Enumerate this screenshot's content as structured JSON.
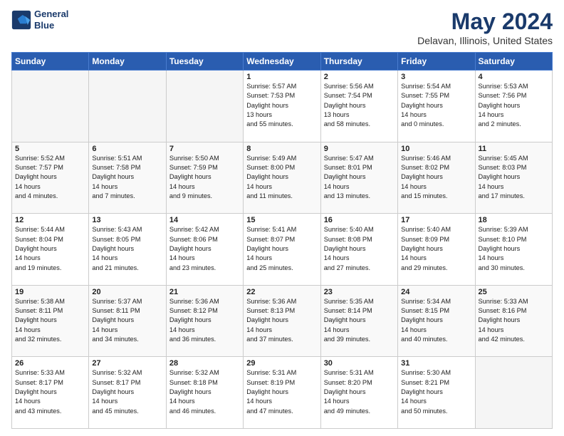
{
  "header": {
    "logo_line1": "General",
    "logo_line2": "Blue",
    "title": "May 2024",
    "subtitle": "Delavan, Illinois, United States"
  },
  "days_of_week": [
    "Sunday",
    "Monday",
    "Tuesday",
    "Wednesday",
    "Thursday",
    "Friday",
    "Saturday"
  ],
  "weeks": [
    [
      {
        "day": "",
        "sunrise": "",
        "sunset": "",
        "daylight": "",
        "empty": true
      },
      {
        "day": "",
        "sunrise": "",
        "sunset": "",
        "daylight": "",
        "empty": true
      },
      {
        "day": "",
        "sunrise": "",
        "sunset": "",
        "daylight": "",
        "empty": true
      },
      {
        "day": "1",
        "sunrise": "5:57 AM",
        "sunset": "7:53 PM",
        "daylight1": "13 hours",
        "daylight2": "and 55 minutes.",
        "empty": false
      },
      {
        "day": "2",
        "sunrise": "5:56 AM",
        "sunset": "7:54 PM",
        "daylight1": "13 hours",
        "daylight2": "and 58 minutes.",
        "empty": false
      },
      {
        "day": "3",
        "sunrise": "5:54 AM",
        "sunset": "7:55 PM",
        "daylight1": "14 hours",
        "daylight2": "and 0 minutes.",
        "empty": false
      },
      {
        "day": "4",
        "sunrise": "5:53 AM",
        "sunset": "7:56 PM",
        "daylight1": "14 hours",
        "daylight2": "and 2 minutes.",
        "empty": false
      }
    ],
    [
      {
        "day": "5",
        "sunrise": "5:52 AM",
        "sunset": "7:57 PM",
        "daylight1": "14 hours",
        "daylight2": "and 4 minutes.",
        "empty": false
      },
      {
        "day": "6",
        "sunrise": "5:51 AM",
        "sunset": "7:58 PM",
        "daylight1": "14 hours",
        "daylight2": "and 7 minutes.",
        "empty": false
      },
      {
        "day": "7",
        "sunrise": "5:50 AM",
        "sunset": "7:59 PM",
        "daylight1": "14 hours",
        "daylight2": "and 9 minutes.",
        "empty": false
      },
      {
        "day": "8",
        "sunrise": "5:49 AM",
        "sunset": "8:00 PM",
        "daylight1": "14 hours",
        "daylight2": "and 11 minutes.",
        "empty": false
      },
      {
        "day": "9",
        "sunrise": "5:47 AM",
        "sunset": "8:01 PM",
        "daylight1": "14 hours",
        "daylight2": "and 13 minutes.",
        "empty": false
      },
      {
        "day": "10",
        "sunrise": "5:46 AM",
        "sunset": "8:02 PM",
        "daylight1": "14 hours",
        "daylight2": "and 15 minutes.",
        "empty": false
      },
      {
        "day": "11",
        "sunrise": "5:45 AM",
        "sunset": "8:03 PM",
        "daylight1": "14 hours",
        "daylight2": "and 17 minutes.",
        "empty": false
      }
    ],
    [
      {
        "day": "12",
        "sunrise": "5:44 AM",
        "sunset": "8:04 PM",
        "daylight1": "14 hours",
        "daylight2": "and 19 minutes.",
        "empty": false
      },
      {
        "day": "13",
        "sunrise": "5:43 AM",
        "sunset": "8:05 PM",
        "daylight1": "14 hours",
        "daylight2": "and 21 minutes.",
        "empty": false
      },
      {
        "day": "14",
        "sunrise": "5:42 AM",
        "sunset": "8:06 PM",
        "daylight1": "14 hours",
        "daylight2": "and 23 minutes.",
        "empty": false
      },
      {
        "day": "15",
        "sunrise": "5:41 AM",
        "sunset": "8:07 PM",
        "daylight1": "14 hours",
        "daylight2": "and 25 minutes.",
        "empty": false
      },
      {
        "day": "16",
        "sunrise": "5:40 AM",
        "sunset": "8:08 PM",
        "daylight1": "14 hours",
        "daylight2": "and 27 minutes.",
        "empty": false
      },
      {
        "day": "17",
        "sunrise": "5:40 AM",
        "sunset": "8:09 PM",
        "daylight1": "14 hours",
        "daylight2": "and 29 minutes.",
        "empty": false
      },
      {
        "day": "18",
        "sunrise": "5:39 AM",
        "sunset": "8:10 PM",
        "daylight1": "14 hours",
        "daylight2": "and 30 minutes.",
        "empty": false
      }
    ],
    [
      {
        "day": "19",
        "sunrise": "5:38 AM",
        "sunset": "8:11 PM",
        "daylight1": "14 hours",
        "daylight2": "and 32 minutes.",
        "empty": false
      },
      {
        "day": "20",
        "sunrise": "5:37 AM",
        "sunset": "8:11 PM",
        "daylight1": "14 hours",
        "daylight2": "and 34 minutes.",
        "empty": false
      },
      {
        "day": "21",
        "sunrise": "5:36 AM",
        "sunset": "8:12 PM",
        "daylight1": "14 hours",
        "daylight2": "and 36 minutes.",
        "empty": false
      },
      {
        "day": "22",
        "sunrise": "5:36 AM",
        "sunset": "8:13 PM",
        "daylight1": "14 hours",
        "daylight2": "and 37 minutes.",
        "empty": false
      },
      {
        "day": "23",
        "sunrise": "5:35 AM",
        "sunset": "8:14 PM",
        "daylight1": "14 hours",
        "daylight2": "and 39 minutes.",
        "empty": false
      },
      {
        "day": "24",
        "sunrise": "5:34 AM",
        "sunset": "8:15 PM",
        "daylight1": "14 hours",
        "daylight2": "and 40 minutes.",
        "empty": false
      },
      {
        "day": "25",
        "sunrise": "5:33 AM",
        "sunset": "8:16 PM",
        "daylight1": "14 hours",
        "daylight2": "and 42 minutes.",
        "empty": false
      }
    ],
    [
      {
        "day": "26",
        "sunrise": "5:33 AM",
        "sunset": "8:17 PM",
        "daylight1": "14 hours",
        "daylight2": "and 43 minutes.",
        "empty": false
      },
      {
        "day": "27",
        "sunrise": "5:32 AM",
        "sunset": "8:17 PM",
        "daylight1": "14 hours",
        "daylight2": "and 45 minutes.",
        "empty": false
      },
      {
        "day": "28",
        "sunrise": "5:32 AM",
        "sunset": "8:18 PM",
        "daylight1": "14 hours",
        "daylight2": "and 46 minutes.",
        "empty": false
      },
      {
        "day": "29",
        "sunrise": "5:31 AM",
        "sunset": "8:19 PM",
        "daylight1": "14 hours",
        "daylight2": "and 47 minutes.",
        "empty": false
      },
      {
        "day": "30",
        "sunrise": "5:31 AM",
        "sunset": "8:20 PM",
        "daylight1": "14 hours",
        "daylight2": "and 49 minutes.",
        "empty": false
      },
      {
        "day": "31",
        "sunrise": "5:30 AM",
        "sunset": "8:21 PM",
        "daylight1": "14 hours",
        "daylight2": "and 50 minutes.",
        "empty": false
      },
      {
        "day": "",
        "sunrise": "",
        "sunset": "",
        "daylight": "",
        "empty": true
      }
    ]
  ]
}
